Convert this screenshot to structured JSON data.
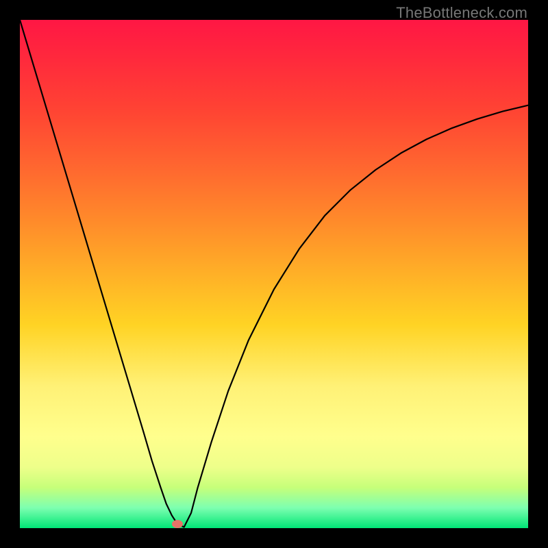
{
  "attribution": "TheBottleneck.com",
  "chart_data": {
    "type": "line",
    "title": "",
    "xlabel": "",
    "ylabel": "",
    "xlim": [
      0,
      100
    ],
    "ylim": [
      0,
      100
    ],
    "grid": false,
    "legend": false,
    "background_gradient": {
      "direction": "vertical",
      "stops": [
        {
          "pos": 0.0,
          "color": "#ff1744"
        },
        {
          "pos": 0.5,
          "color": "#ffc924"
        },
        {
          "pos": 0.82,
          "color": "#ffff8d"
        },
        {
          "pos": 1.0,
          "color": "#00e676"
        }
      ],
      "meaning": "top=red(bad), bottom=green(good)"
    },
    "series": [
      {
        "name": "bottleneck-curve",
        "color": "#000000",
        "x": [
          0.0,
          2.7,
          5.4,
          8.1,
          10.8,
          13.5,
          16.2,
          18.9,
          21.6,
          24.3,
          26.0,
          27.7,
          28.8,
          29.9,
          31.0,
          32.3,
          33.7,
          35.0,
          37.7,
          41.0,
          45.0,
          50.0,
          55.0,
          60.0,
          65.0,
          70.0,
          75.0,
          80.0,
          85.0,
          90.0,
          95.0,
          100.0
        ],
        "y": [
          100.0,
          91.0,
          82.0,
          73.0,
          64.0,
          55.0,
          46.0,
          37.0,
          28.0,
          19.0,
          13.2,
          8.0,
          4.8,
          2.5,
          0.8,
          0.2,
          3.0,
          8.0,
          17.0,
          27.0,
          37.0,
          47.0,
          55.0,
          61.5,
          66.5,
          70.5,
          73.8,
          76.5,
          78.7,
          80.5,
          82.0,
          83.2
        ]
      }
    ],
    "markers": [
      {
        "name": "optimal-point",
        "x": 31.0,
        "y": 0.8,
        "color": "#e57368",
        "shape": "ellipse"
      }
    ],
    "annotations": []
  }
}
